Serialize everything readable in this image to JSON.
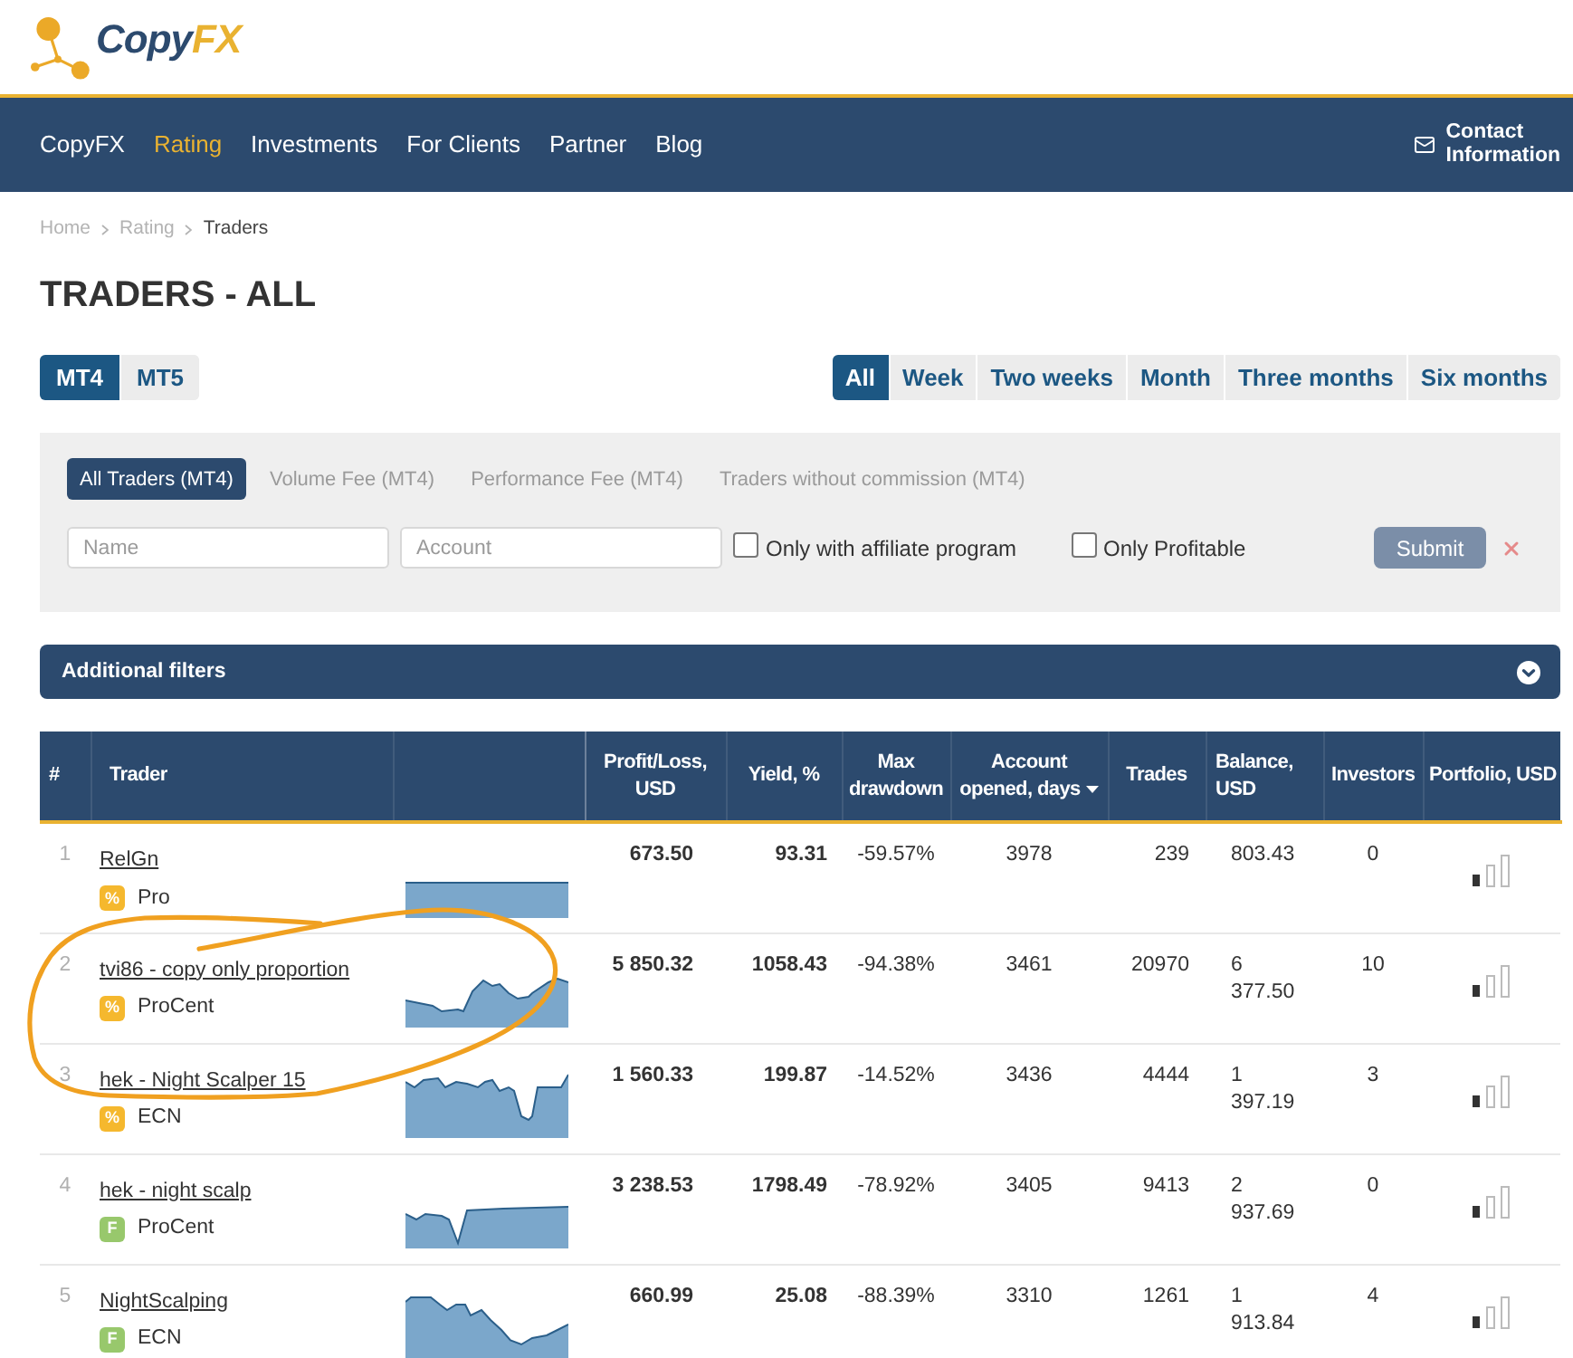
{
  "logo": {
    "text": "Copy",
    "accent": "FX"
  },
  "nav": {
    "items": [
      {
        "label": "CopyFX",
        "selected": false
      },
      {
        "label": "Rating",
        "selected": true
      },
      {
        "label": "Investments",
        "selected": false
      },
      {
        "label": "For Clients",
        "selected": false
      },
      {
        "label": "Partner",
        "selected": false
      },
      {
        "label": "Blog",
        "selected": false
      }
    ],
    "contact": "Contact Information"
  },
  "breadcrumb": [
    {
      "label": "Home",
      "current": false
    },
    {
      "label": "Rating",
      "current": false
    },
    {
      "label": "Traders",
      "current": true
    }
  ],
  "title": "TRADERS - ALL",
  "platform_tabs": [
    {
      "label": "MT4",
      "selected": true
    },
    {
      "label": "MT5",
      "selected": false
    }
  ],
  "period_tabs": [
    {
      "label": "All",
      "selected": true
    },
    {
      "label": "Week",
      "selected": false
    },
    {
      "label": "Two weeks",
      "selected": false
    },
    {
      "label": "Month",
      "selected": false
    },
    {
      "label": "Three months",
      "selected": false
    },
    {
      "label": "Six months",
      "selected": false
    }
  ],
  "filters": {
    "tabs": [
      {
        "label": "All Traders (MT4)",
        "selected": true
      },
      {
        "label": "Volume Fee (MT4)",
        "selected": false
      },
      {
        "label": "Performance Fee (MT4)",
        "selected": false
      },
      {
        "label": "Traders without commission (MT4)",
        "selected": false
      }
    ],
    "fields": [
      {
        "placeholder": "Name"
      },
      {
        "placeholder": "Account"
      }
    ],
    "checkboxes": [
      {
        "label": "Only with affiliate program",
        "checked": false
      },
      {
        "label": "Only Profitable",
        "checked": false
      }
    ],
    "submit": "Submit"
  },
  "additional_filters": {
    "label": "Additional filters",
    "expanded": false
  },
  "table": {
    "columns": [
      {
        "kind": "label",
        "label": "#"
      },
      {
        "kind": "label",
        "label": "Trader"
      },
      {
        "kind": "chart"
      },
      {
        "kind": "label",
        "label": "Profit/Loss, USD"
      },
      {
        "kind": "label",
        "label": "Yield, %"
      },
      {
        "kind": "label",
        "label": "Max drawdown"
      },
      {
        "kind": "label",
        "label": "Account opened, days",
        "sorted": true
      },
      {
        "kind": "label",
        "label": "Trades"
      },
      {
        "kind": "label",
        "label": "Balance, USD"
      },
      {
        "kind": "label",
        "label": "Investors"
      },
      {
        "kind": "label",
        "label": "Portfolio, USD"
      }
    ],
    "rows": [
      {
        "number": "1",
        "trader": "RelGn",
        "badge": {
          "symbol": "%",
          "color": "#f5b82e"
        },
        "account_type": "Pro",
        "profit": "673.50",
        "yield": "93.31",
        "max_drawdown": "-59.57%",
        "account_opened_days": "3978",
        "trades": "239",
        "balance": "803.43",
        "investors": "0"
      },
      {
        "number": "2",
        "trader": "tvi86 - copy only proportion",
        "badge": {
          "symbol": "%",
          "color": "#f5b82e"
        },
        "account_type": "ProCent",
        "profit": "5 850.32",
        "yield": "1058.43",
        "max_drawdown": "-94.38%",
        "account_opened_days": "3461",
        "trades": "20970",
        "balance": "6 377.50",
        "investors": "10"
      },
      {
        "number": "3",
        "trader": "hek - Night Scalper 15",
        "badge": {
          "symbol": "%",
          "color": "#f5b82e"
        },
        "account_type": "ECN",
        "profit": "1 560.33",
        "yield": "199.87",
        "max_drawdown": "-14.52%",
        "account_opened_days": "3436",
        "trades": "4444",
        "balance": "1 397.19",
        "investors": "3"
      },
      {
        "number": "4",
        "trader": "hek - night scalp",
        "badge": {
          "symbol": "F",
          "color": "#98c86c"
        },
        "account_type": "ProCent",
        "profit": "3 238.53",
        "yield": "1798.49",
        "max_drawdown": "-78.92%",
        "account_opened_days": "3405",
        "trades": "9413",
        "balance": "2 937.69",
        "investors": "0"
      },
      {
        "number": "5",
        "trader": "NightScalping",
        "badge": {
          "symbol": "F",
          "color": "#98c86c"
        },
        "account_type": "ECN",
        "profit": "660.99",
        "yield": "25.08",
        "max_drawdown": "-88.39%",
        "account_opened_days": "3310",
        "trades": "1261",
        "balance": "1 913.84",
        "investors": "4"
      }
    ]
  }
}
